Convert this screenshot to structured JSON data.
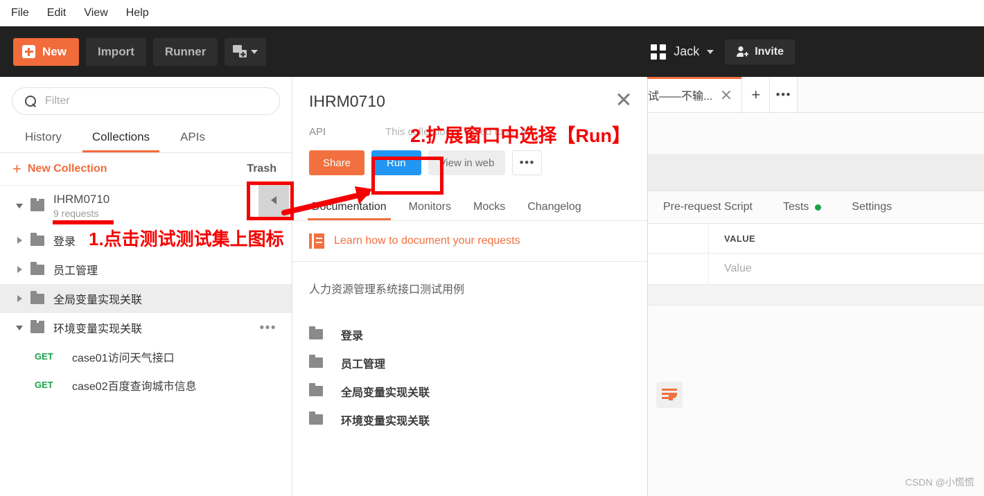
{
  "menubar": {
    "items": [
      "File",
      "Edit",
      "View",
      "Help"
    ]
  },
  "toolbar": {
    "new_label": "New",
    "import_label": "Import",
    "runner_label": "Runner",
    "new_window_icon": "new-window-icon",
    "user_name": "Jack",
    "invite_label": "Invite",
    "grid_icon": "grid-icon",
    "person_add_icon": "person-add-icon",
    "accent_orange": "#f26b3a",
    "bar_background": "#212121"
  },
  "sidebar": {
    "search": {
      "placeholder": "Filter",
      "value": "",
      "icon": "search-icon"
    },
    "tabs": [
      {
        "label": "History",
        "active": false
      },
      {
        "label": "Collections",
        "active": true
      },
      {
        "label": "APIs",
        "active": false
      }
    ],
    "new_collection_label": "New Collection",
    "new_collection_plus": "+",
    "trash_label": "Trash",
    "collection": {
      "name": "IHRM0710",
      "requests_count": "9 requests",
      "expanded": true
    },
    "tree": [
      {
        "label": "登录",
        "type": "folder",
        "expanded": false,
        "selected": false
      },
      {
        "label": "员工管理",
        "type": "folder",
        "expanded": false,
        "selected": false
      },
      {
        "label": "全局变量实现关联",
        "type": "folder",
        "expanded": false,
        "selected": true
      },
      {
        "label": "环境变量实现关联",
        "type": "folder",
        "expanded": true,
        "selected": false,
        "has_menu": true
      }
    ],
    "requests": [
      {
        "method": "GET",
        "name": "case01访问天气接口"
      },
      {
        "method": "GET",
        "name": "case02百度查询城市信息"
      }
    ],
    "collapse_arrow_icon": "caret-left-icon"
  },
  "detail_panel": {
    "title": "IHRM0710",
    "close_icon": "close-icon",
    "meta_label": "API",
    "meta_description": "This collection is linked to an API",
    "actions": {
      "share": "Share",
      "run": "Run",
      "view_in_web": "View in web",
      "more": "•••"
    },
    "tabs": [
      {
        "label": "Documentation",
        "active": true
      },
      {
        "label": "Monitors",
        "active": false
      },
      {
        "label": "Mocks",
        "active": false
      },
      {
        "label": "Changelog",
        "active": false
      }
    ],
    "learn_link": "Learn how to document your requests",
    "learn_icon": "document-icon",
    "description": "人力资源管理系统接口测试用例",
    "folders": [
      "登录",
      "员工管理",
      "全局变量实现关联",
      "环境变量实现关联"
    ],
    "share_color": "#f2703f",
    "run_color": "#2196f3"
  },
  "main": {
    "request_tab_label": "试——不输...",
    "tab_close_icon": "close-icon",
    "add_tab_icon": "plus-icon",
    "tab_options_icon": "ellipsis-icon",
    "tabs": [
      {
        "label": "Pre-request Script",
        "active": false,
        "dot": false
      },
      {
        "label": "Tests",
        "active": false,
        "dot": true
      },
      {
        "label": "Settings",
        "active": false,
        "dot": false
      }
    ],
    "table": {
      "headers": [
        "",
        "VALUE"
      ],
      "rows": [
        [
          "",
          "Value"
        ]
      ]
    },
    "wrap_button_icon": "word-wrap-icon",
    "dot_color": "#1aa34a"
  },
  "annotations": {
    "step1": "1.点击测试测试集上图标",
    "step2": "2.扩展窗口中选择【Run】",
    "color": "#f50000"
  },
  "watermark": "CSDN @小慌慌"
}
